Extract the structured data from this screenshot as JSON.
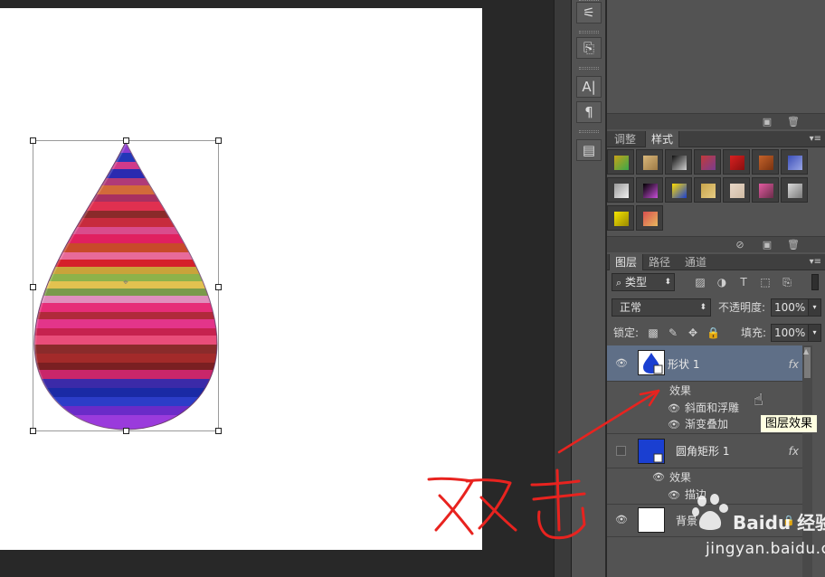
{
  "panels": {
    "styles": {
      "tabs": [
        {
          "label": "调整",
          "active": false
        },
        {
          "label": "样式",
          "active": true
        }
      ],
      "swatch_colors": [
        [
          "#c8a218",
          "#3aa84a"
        ],
        [
          "#d9b77a",
          "#9e7b46"
        ],
        [
          "#101010",
          "#d0d0d0"
        ],
        [
          "#c23a3a",
          "#7a3d8f"
        ],
        [
          "#d82020",
          "#8a0f0f"
        ],
        [
          "#c5622a",
          "#7a3310"
        ],
        [
          "#3b4fb8",
          "#9aa6e6"
        ],
        [
          "#9a9a9a",
          "#f0f0f0"
        ],
        [
          "#000000",
          "#c84fd8"
        ],
        [
          "#ffdd00",
          "#1a3fd1"
        ],
        [
          "#c9a54a",
          "#e6cc85"
        ],
        [
          "#e7d6c6",
          "#d1bca5"
        ],
        [
          "#e25aa0",
          "#6a2d4a"
        ],
        [
          "#dadada",
          "#7a7a7a"
        ],
        [
          "#f5e400",
          "#9a8a00"
        ],
        [
          "#d94f4f",
          "#e7b85e"
        ]
      ]
    },
    "layers": {
      "tabs": [
        {
          "label": "图层",
          "active": true
        },
        {
          "label": "路径",
          "active": false
        },
        {
          "label": "通道",
          "active": false
        }
      ],
      "filter_label": "类型",
      "blend_mode": "正常",
      "opacity_label": "不透明度:",
      "opacity_value": "100%",
      "lock_label": "锁定:",
      "fill_label": "填充:",
      "fill_value": "100%",
      "rows": [
        {
          "name": "形状 1",
          "fx": "fx",
          "effects_label": "效果",
          "effects": [
            "斜面和浮雕",
            "渐变叠加"
          ]
        },
        {
          "name": "圆角矩形 1",
          "fx": "fx",
          "effects_label": "效果",
          "effects": [
            "描边"
          ]
        },
        {
          "name": "背景"
        }
      ]
    }
  },
  "tooltip": "图层效果",
  "annotation": {
    "handwriting": "双击",
    "color": "#e8231f"
  },
  "watermark": {
    "brand": "Baidu 经验",
    "url": "jingyan.baidu.com"
  },
  "colors": {
    "workspace": "#282828",
    "panel": "#535353",
    "selected_layer": "#5f6f87",
    "annotation_red": "#e8231f"
  }
}
